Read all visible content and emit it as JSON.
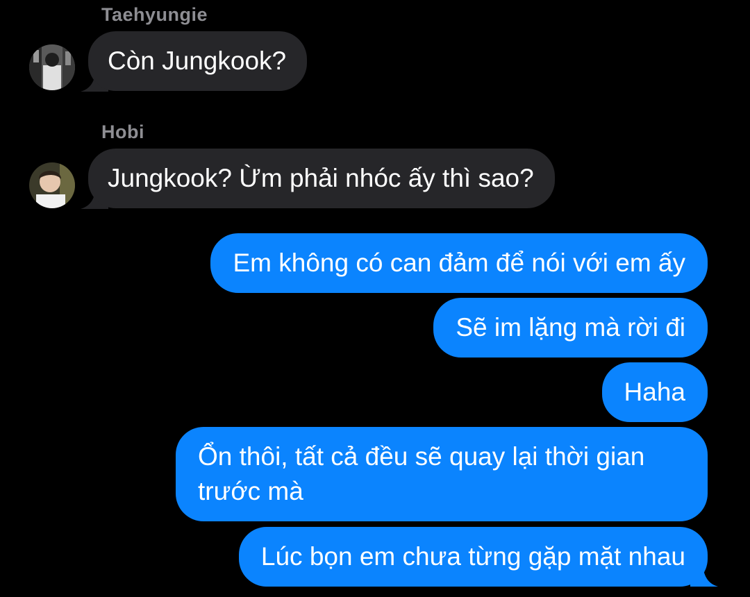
{
  "conversation": {
    "messages": [
      {
        "sender": "Taehyungie",
        "text": "Còn Jungkook?",
        "direction": "incoming"
      },
      {
        "sender": "Hobi",
        "text": "Jungkook? Ừm phải nhóc ấy thì sao?",
        "direction": "incoming"
      },
      {
        "text": "Em không có can đảm để nói với em ấy",
        "direction": "outgoing"
      },
      {
        "text": "Sẽ im lặng mà rời đi",
        "direction": "outgoing"
      },
      {
        "text": "Haha",
        "direction": "outgoing"
      },
      {
        "text": "Ổn thôi, tất cả đều sẽ quay lại thời gian trước mà",
        "direction": "outgoing"
      },
      {
        "text": "Lúc bọn em chưa từng gặp mặt nhau",
        "direction": "outgoing"
      }
    ]
  },
  "colors": {
    "background": "#000000",
    "incoming_bubble": "#262629",
    "outgoing_bubble": "#0b84fe",
    "sender_name": "#8e8e93"
  }
}
